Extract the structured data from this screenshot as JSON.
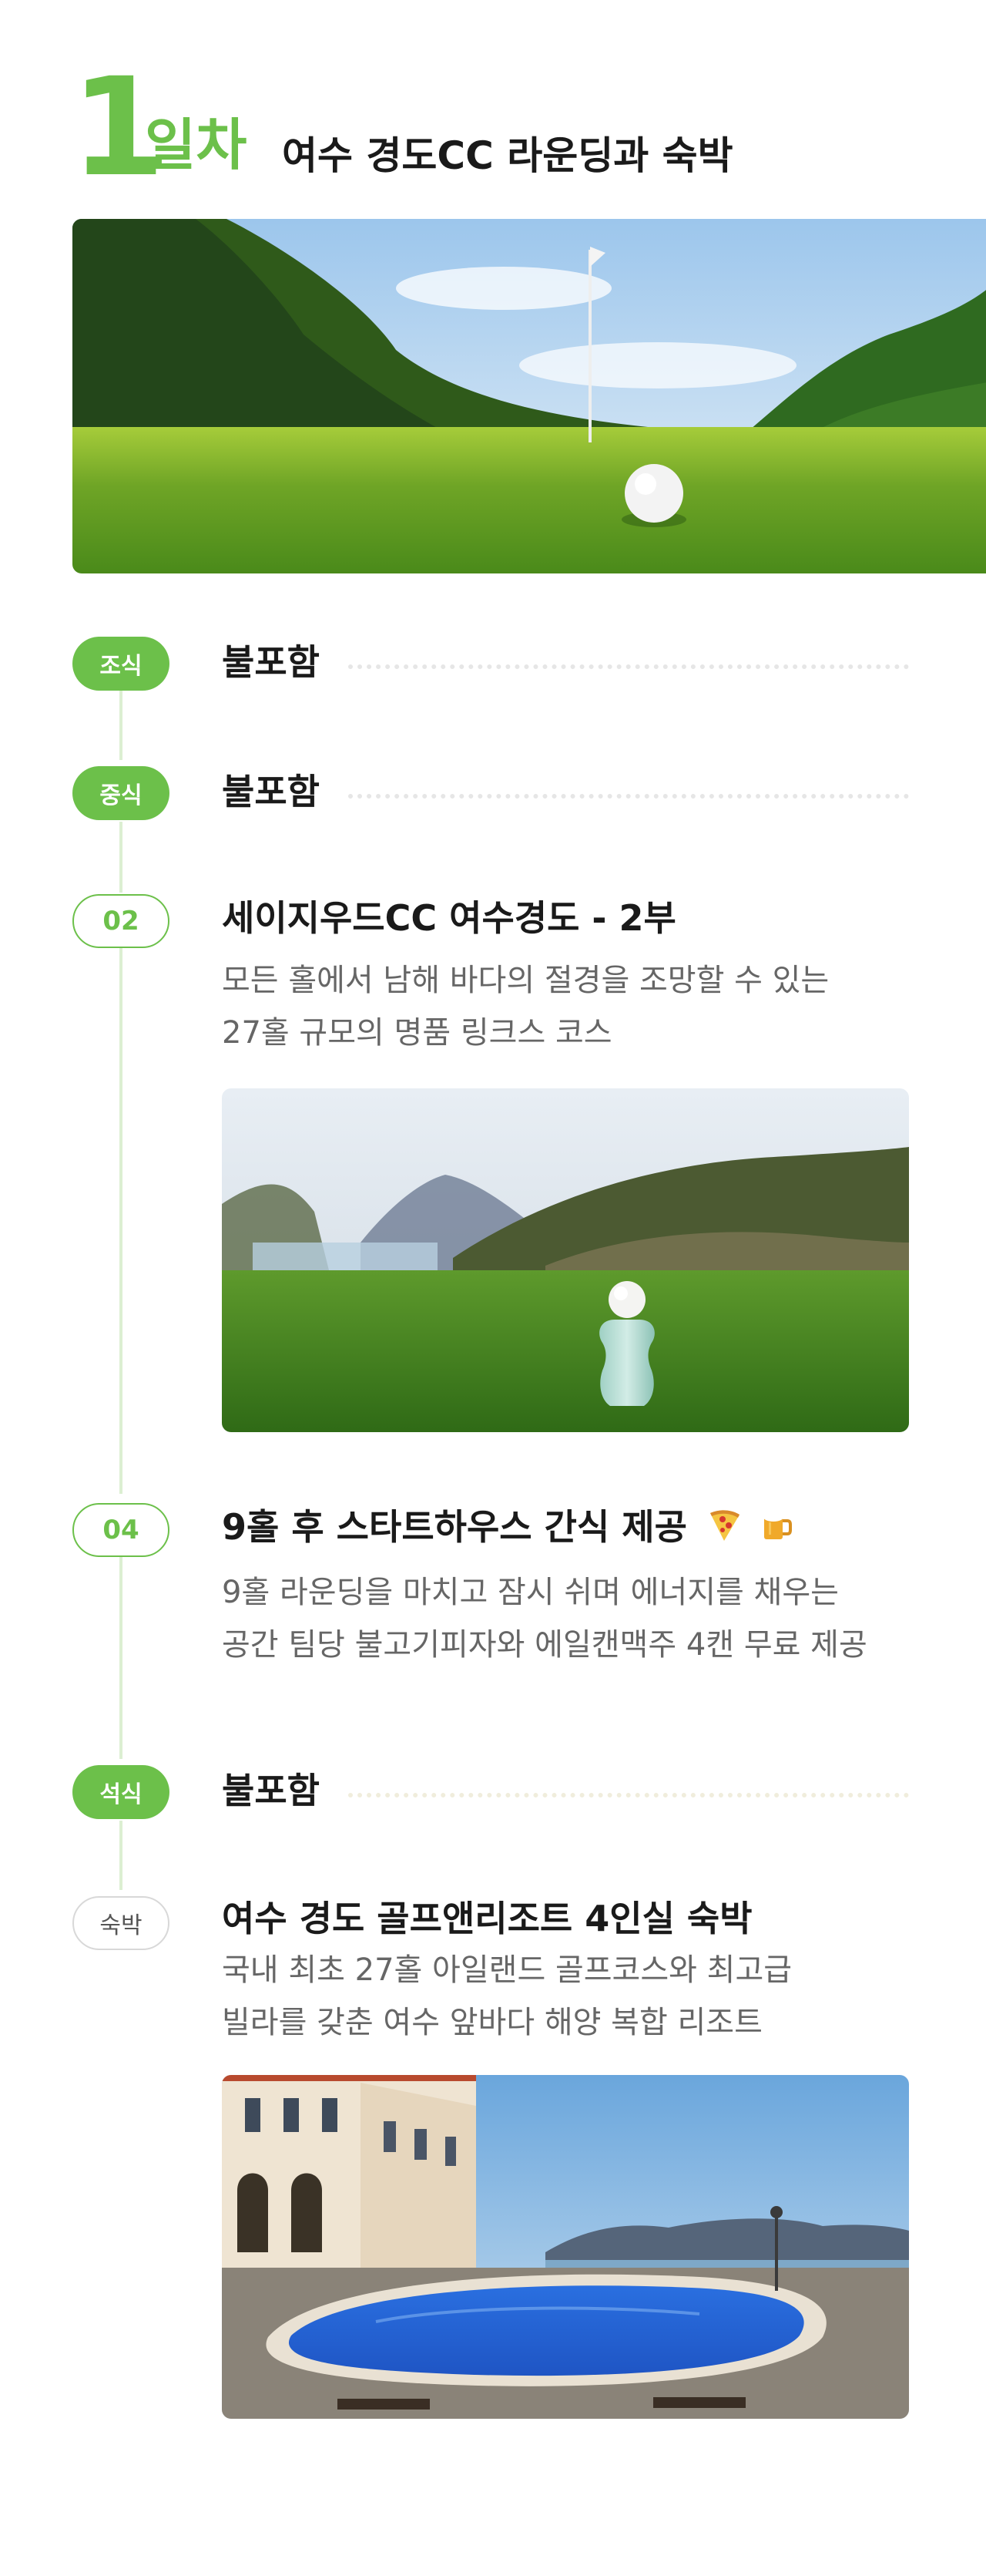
{
  "header": {
    "day_number": "1",
    "day_unit": "일차",
    "title": "여수 경도CC 라운딩과 숙박"
  },
  "timeline": {
    "breakfast": {
      "badge": "조식",
      "title": "불포함"
    },
    "lunch": {
      "badge": "중식",
      "title": "불포함"
    },
    "step02": {
      "badge": "02",
      "title": "세이지우드CC 여수경도 - 2부",
      "desc_line1": "모든 홀에서 남해 바다의 절경을 조망할 수 있는",
      "desc_line2": "27홀 규모의 명품 링크스 코스"
    },
    "step04": {
      "badge": "04",
      "title": "9홀 후 스타트하우스 간식 제공",
      "desc_line1": "9홀 라운딩을 마치고 잠시 쉬며 에너지를 채우는",
      "desc_line2": "공간 팀당 불고기피자와 에일캔맥주 4캔 무료 제공"
    },
    "dinner": {
      "badge": "석식",
      "title": "불포함"
    },
    "lodging": {
      "badge": "숙박",
      "title": "여수 경도 골프앤리조트 4인실 숙박",
      "desc_line1": "국내 최초 27홀 아일랜드 골프코스와 최고급",
      "desc_line2": "빌라를 갖춘 여수 앞바다 해양 복합 리조트"
    }
  },
  "icons": {
    "pizza": "pizza-icon",
    "beer": "beer-icon"
  },
  "colors": {
    "accent": "#6cc04a",
    "timeline_line": "#dcefd2",
    "text": "#1a1a1a",
    "muted": "#666666"
  }
}
